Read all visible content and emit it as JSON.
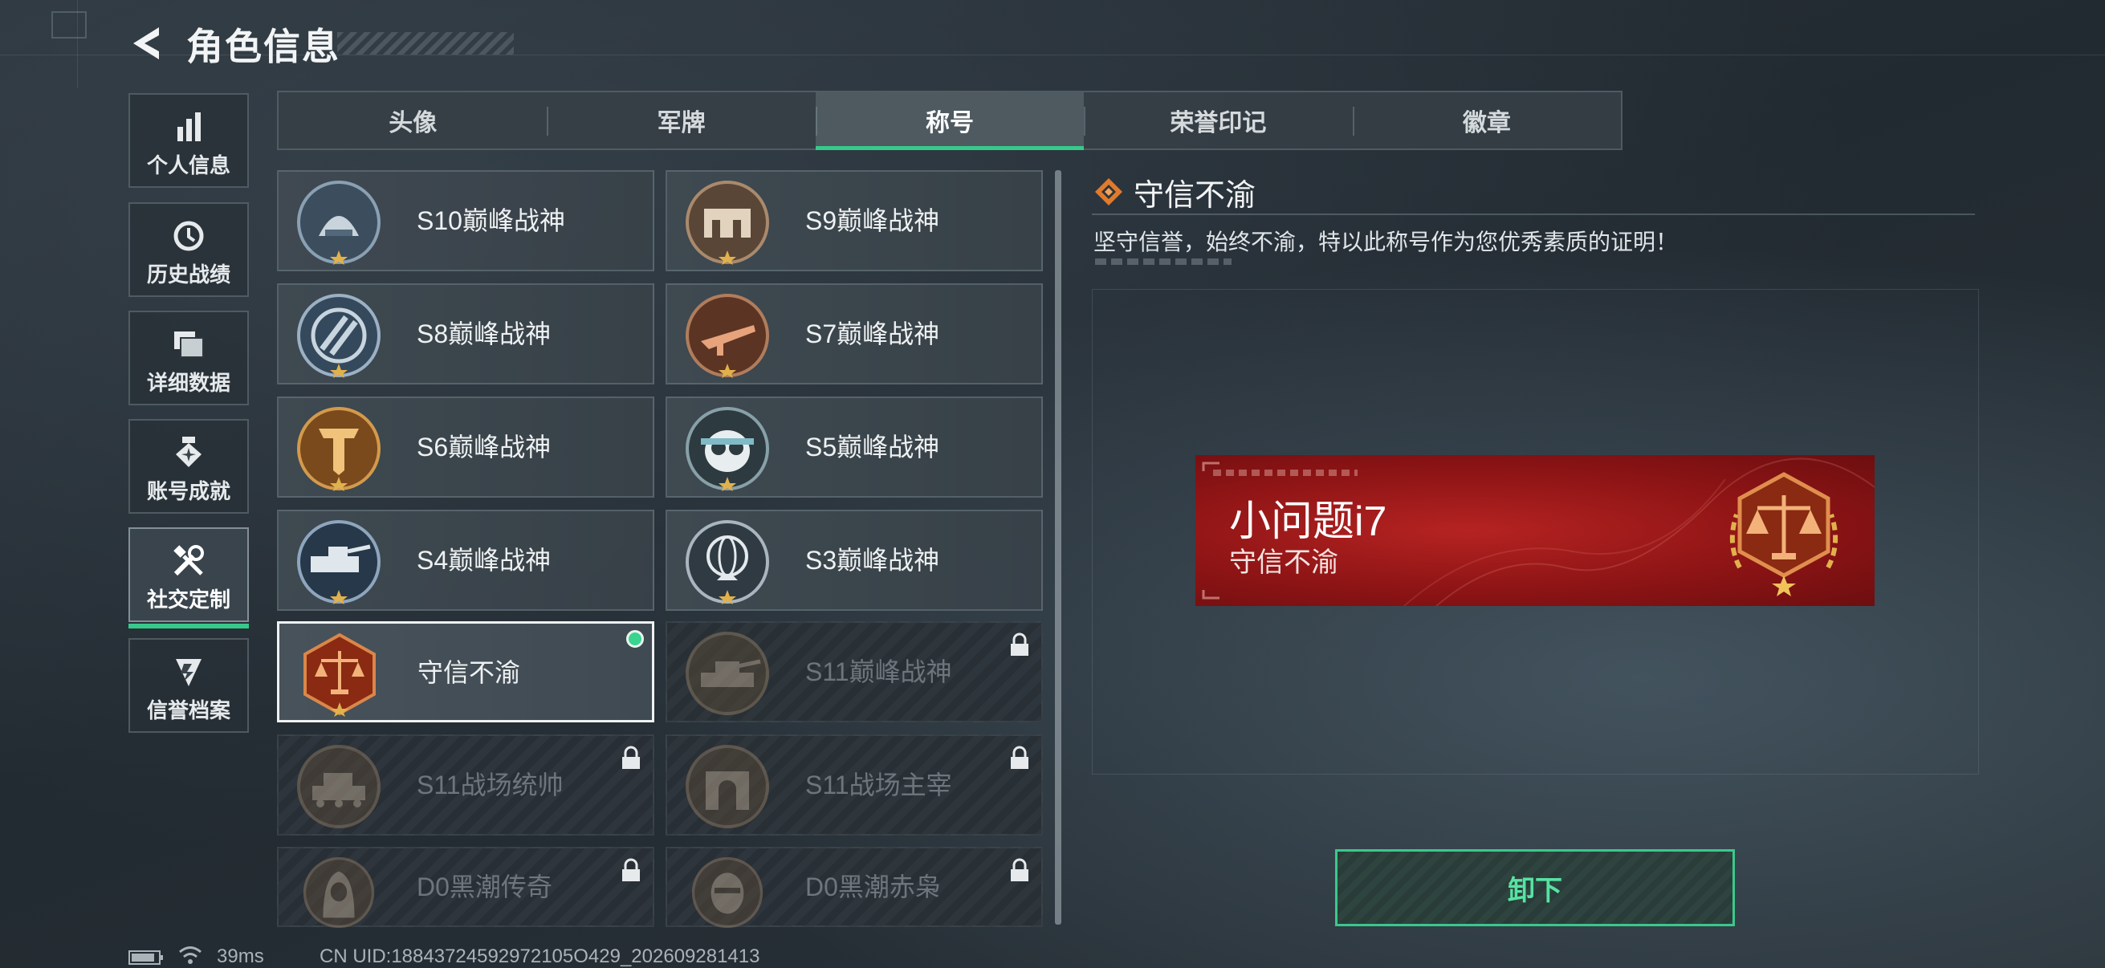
{
  "header": {
    "title": "角色信息"
  },
  "nav": [
    {
      "label": "个人信息",
      "icon": "bar-chart-icon"
    },
    {
      "label": "历史战绩",
      "icon": "history-clock-icon"
    },
    {
      "label": "详细数据",
      "icon": "folder-icon"
    },
    {
      "label": "账号成就",
      "icon": "medal-icon"
    },
    {
      "label": "社交定制",
      "icon": "wrench-screwdriver-icon",
      "active": true
    },
    {
      "label": "信誉档案",
      "icon": "shield-chevron-icon"
    }
  ],
  "tabs": [
    {
      "label": "头像"
    },
    {
      "label": "军牌"
    },
    {
      "label": "称号",
      "active": true
    },
    {
      "label": "荣誉印记"
    },
    {
      "label": "徽章"
    }
  ],
  "titles": [
    {
      "name": "S10巅峰战神",
      "state": "unlocked",
      "icon": "helmet-emblem-icon"
    },
    {
      "name": "S9巅峰战神",
      "state": "unlocked",
      "icon": "fortress-emblem-icon"
    },
    {
      "name": "S8巅峰战神",
      "state": "unlocked",
      "icon": "slash-emblem-icon"
    },
    {
      "name": "S7巅峰战神",
      "state": "unlocked",
      "icon": "rifle-emblem-icon"
    },
    {
      "name": "S6巅峰战神",
      "state": "unlocked",
      "icon": "t-shield-emblem-icon"
    },
    {
      "name": "S5巅峰战神",
      "state": "unlocked",
      "icon": "skull-mask-emblem-icon"
    },
    {
      "name": "S4巅峰战神",
      "state": "unlocked",
      "icon": "armored-vehicle-emblem-icon"
    },
    {
      "name": "S3巅峰战神",
      "state": "unlocked",
      "icon": "globe-emblem-icon"
    },
    {
      "name": "守信不渝",
      "state": "equipped",
      "icon": "scales-emblem-icon"
    },
    {
      "name": "S11巅峰战神",
      "state": "locked",
      "icon": "tank-emblem-icon"
    },
    {
      "name": "S11战场统帅",
      "state": "locked",
      "icon": "tank-emblem-icon"
    },
    {
      "name": "S11战场主宰",
      "state": "locked",
      "icon": "arch-emblem-icon"
    },
    {
      "name": "D0黑潮传奇",
      "state": "locked",
      "icon": "hooded-figure-emblem-icon"
    },
    {
      "name": "D0黑潮赤枭",
      "state": "locked",
      "icon": "masked-face-emblem-icon"
    }
  ],
  "detail": {
    "title": "守信不渝",
    "description": "坚守信誉，始终不渝，特以此称号作为您优秀素质的证明！"
  },
  "nameplate": {
    "player_name": "小问题i7",
    "title": "守信不渝"
  },
  "actions": {
    "unequip_label": "卸下"
  },
  "status": {
    "ping": "39ms",
    "uid": "CN UID:18843724592972105O429_202609281413"
  },
  "colors": {
    "accent_green": "#37c98b",
    "nameplate_red": "#a01a1b",
    "gold": "#d69a45"
  }
}
